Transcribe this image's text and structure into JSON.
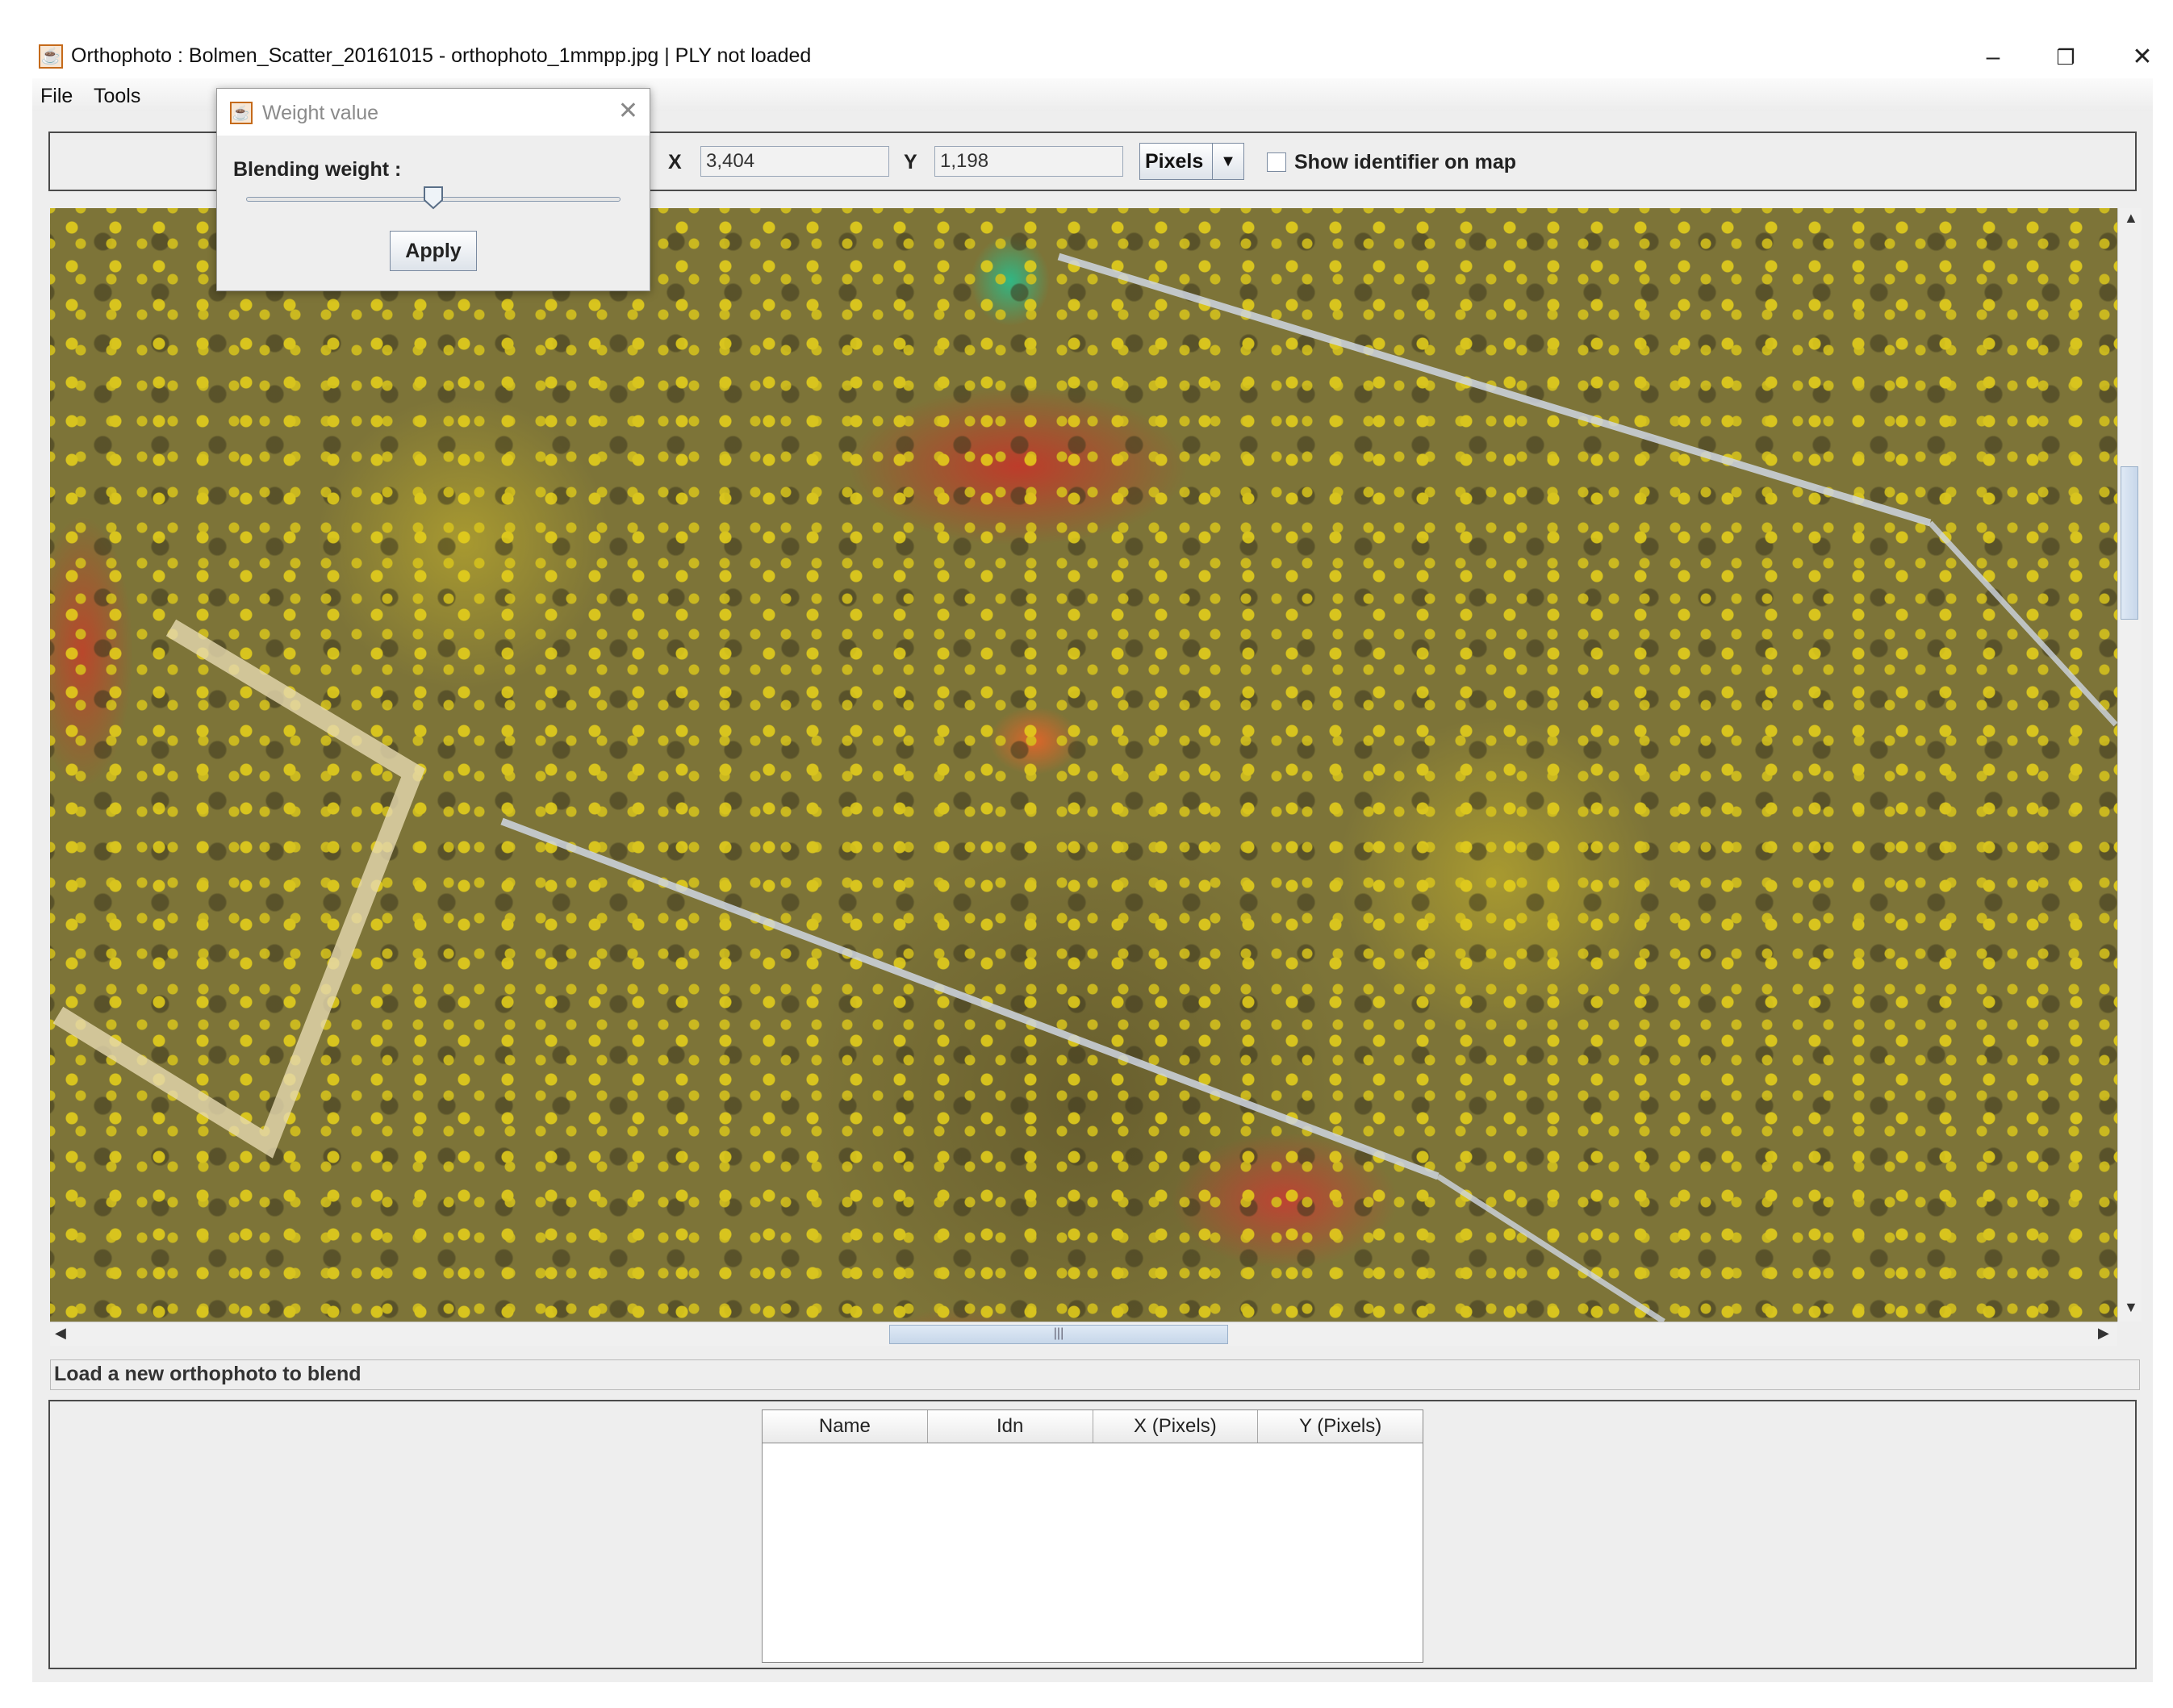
{
  "window": {
    "title": "Orthophoto : Bolmen_Scatter_20161015 - orthophoto_1mmpp.jpg | PLY not loaded",
    "minimize": "–",
    "maximize": "❐",
    "close": "✕"
  },
  "menu": [
    "File",
    "Tools"
  ],
  "toolbar": {
    "x_label": "X",
    "x_value": "3,404",
    "y_label": "Y",
    "y_value": "1,198",
    "units_selected": "Pixels",
    "show_identifier_label": "Show identifier on map",
    "show_identifier_checked": false
  },
  "status": "Load a  new orthophoto to blend",
  "table": {
    "columns": [
      "Name",
      "Idn",
      "X (Pixels)",
      "Y (Pixels)"
    ],
    "rows": []
  },
  "dialog": {
    "title": "Weight value",
    "label": "Blending weight :",
    "slider_value": 0.5,
    "apply_label": "Apply"
  }
}
